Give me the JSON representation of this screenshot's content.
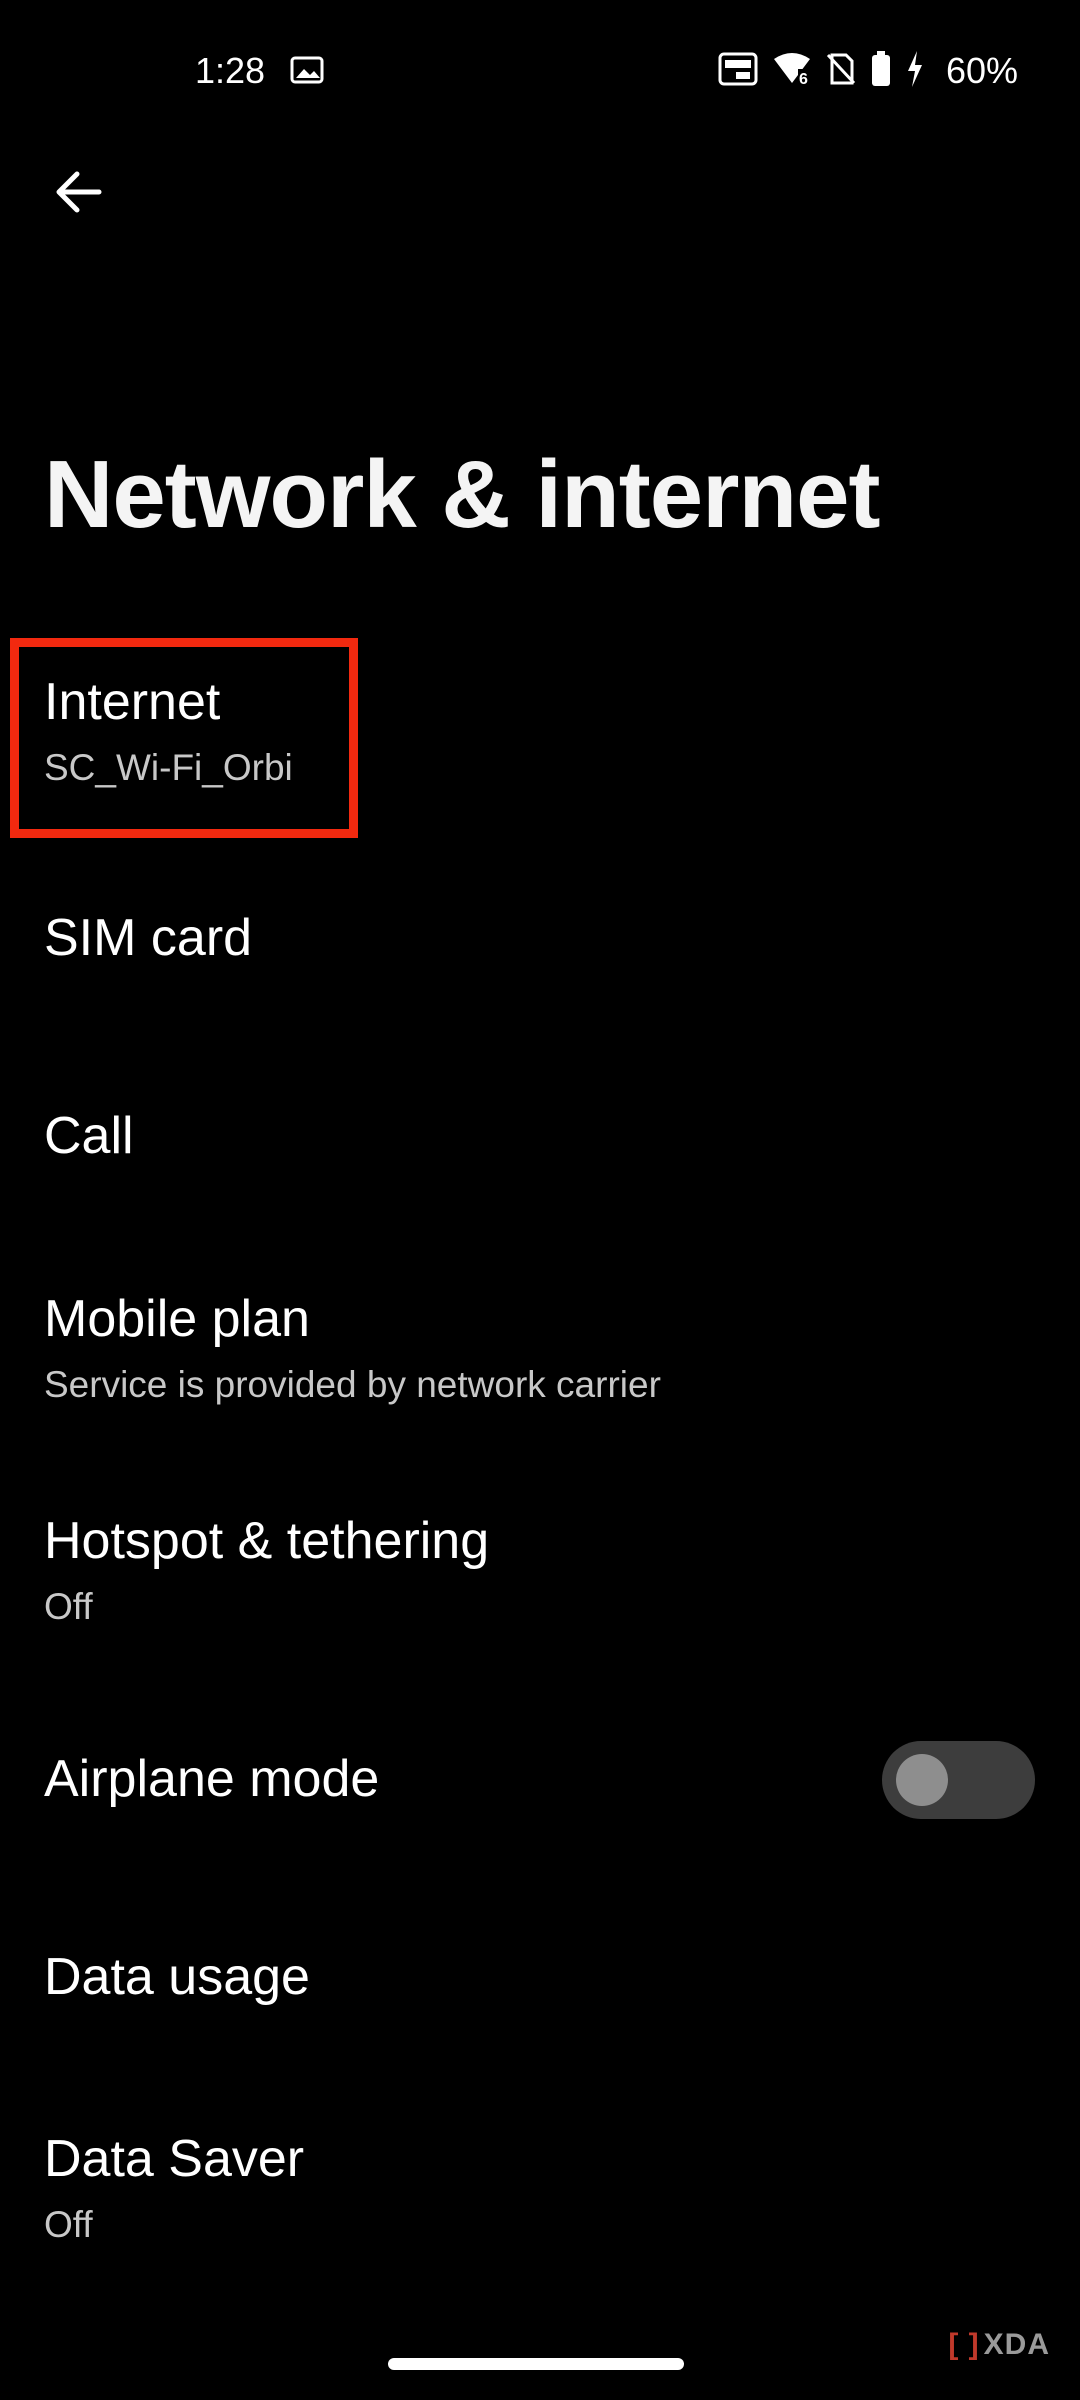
{
  "status_bar": {
    "time": "1:28",
    "battery_percent": "60%",
    "icons": [
      "gallery-icon",
      "auto-hz-icon",
      "wifi-6-icon",
      "no-sim-icon",
      "battery-icon",
      "charging-icon"
    ]
  },
  "header": {
    "title": "Network & internet"
  },
  "settings": {
    "internet": {
      "title": "Internet",
      "subtitle": "SC_Wi-Fi_Orbi"
    },
    "sim": {
      "title": "SIM card"
    },
    "call": {
      "title": "Call"
    },
    "mobile_plan": {
      "title": "Mobile plan",
      "subtitle": "Service is provided by network carrier"
    },
    "hotspot": {
      "title": "Hotspot & tethering",
      "subtitle": "Off"
    },
    "airplane": {
      "title": "Airplane mode",
      "enabled": false
    },
    "data_usage": {
      "title": "Data usage"
    },
    "data_saver": {
      "title": "Data Saver",
      "subtitle": "Off"
    }
  },
  "annotation": {
    "highlight_color": "#f2290f"
  },
  "watermark": {
    "text": "XDA"
  }
}
